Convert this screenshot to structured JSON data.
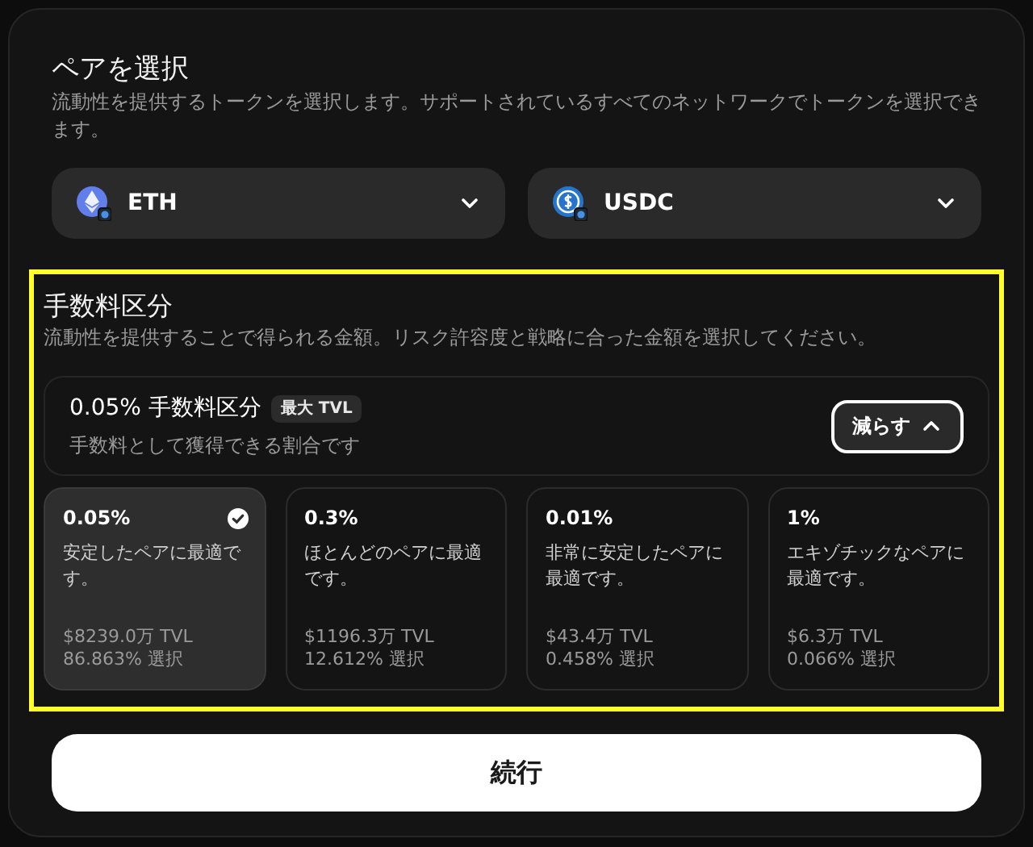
{
  "pair_section": {
    "title": "ペアを選択",
    "description": "流動性を提供するトークンを選択します。サポートされているすべてのネットワークでトークンを選択できます。",
    "tokens": [
      {
        "symbol": "ETH",
        "kind": "eth"
      },
      {
        "symbol": "USDC",
        "kind": "usdc"
      }
    ]
  },
  "fee_section": {
    "highlighted": true,
    "title": "手数料区分",
    "description": "流動性を提供することで得られる金額。リスク許容度と戦略に合った金額を選択してください。",
    "summary": {
      "title": "0.05% 手数料区分",
      "badge": "最大 TVL",
      "subtitle": "手数料として獲得できる割合です",
      "toggle_label": "減らす",
      "expanded": true
    },
    "tiers": [
      {
        "fee": "0.05%",
        "description": "安定したペアに最適です。",
        "tvl": "$8239.0万 TVL",
        "share": "86.863% 選択",
        "selected": true
      },
      {
        "fee": "0.3%",
        "description": "ほとんどのペアに最適です。",
        "tvl": "$1196.3万 TVL",
        "share": "12.612% 選択",
        "selected": false
      },
      {
        "fee": "0.01%",
        "description": "非常に安定したペアに最適です。",
        "tvl": "$43.4万 TVL",
        "share": "0.458% 選択",
        "selected": false
      },
      {
        "fee": "1%",
        "description": "エキゾチックなペアに最適です。",
        "tvl": "$6.3万 TVL",
        "share": "0.066% 選択",
        "selected": false
      }
    ]
  },
  "continue_button": "続行"
}
